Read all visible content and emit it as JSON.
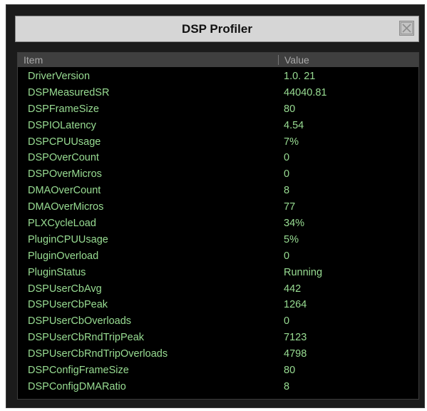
{
  "window": {
    "title": "DSP Profiler"
  },
  "table": {
    "headers": {
      "item": "Item",
      "value": "Value"
    },
    "rows": [
      {
        "item": "DriverVersion",
        "value": "1.0. 21"
      },
      {
        "item": "DSPMeasuredSR",
        "value": "44040.81"
      },
      {
        "item": "DSPFrameSize",
        "value": "80"
      },
      {
        "item": "DSPIOLatency",
        "value": "4.54"
      },
      {
        "item": "DSPCPUUsage",
        "value": "7%"
      },
      {
        "item": "DSPOverCount",
        "value": "0"
      },
      {
        "item": "DSPOverMicros",
        "value": "0"
      },
      {
        "item": "DMAOverCount",
        "value": "8"
      },
      {
        "item": "DMAOverMicros",
        "value": "77"
      },
      {
        "item": "PLXCycleLoad",
        "value": "34%"
      },
      {
        "item": "PluginCPUUsage",
        "value": "5%"
      },
      {
        "item": "PluginOverload",
        "value": "0"
      },
      {
        "item": "PluginStatus",
        "value": "Running"
      },
      {
        "item": "DSPUserCbAvg",
        "value": "442"
      },
      {
        "item": "DSPUserCbPeak",
        "value": "1264"
      },
      {
        "item": "DSPUserCbOverloads",
        "value": "0"
      },
      {
        "item": "DSPUserCbRndTripPeak",
        "value": "7123"
      },
      {
        "item": "DSPUserCbRndTripOverloads",
        "value": "4798"
      },
      {
        "item": "DSPConfigFrameSize",
        "value": "80"
      },
      {
        "item": "DSPConfigDMARatio",
        "value": "8"
      }
    ]
  },
  "icons": {
    "close": "close-icon"
  },
  "colors": {
    "window_bg": "#1b1b1b",
    "titlebar_bg": "#d6d6d6",
    "table_bg": "#000000",
    "header_bg": "#3f3f3f",
    "header_text": "#a9a9a9",
    "row_text": "#98dc92"
  }
}
